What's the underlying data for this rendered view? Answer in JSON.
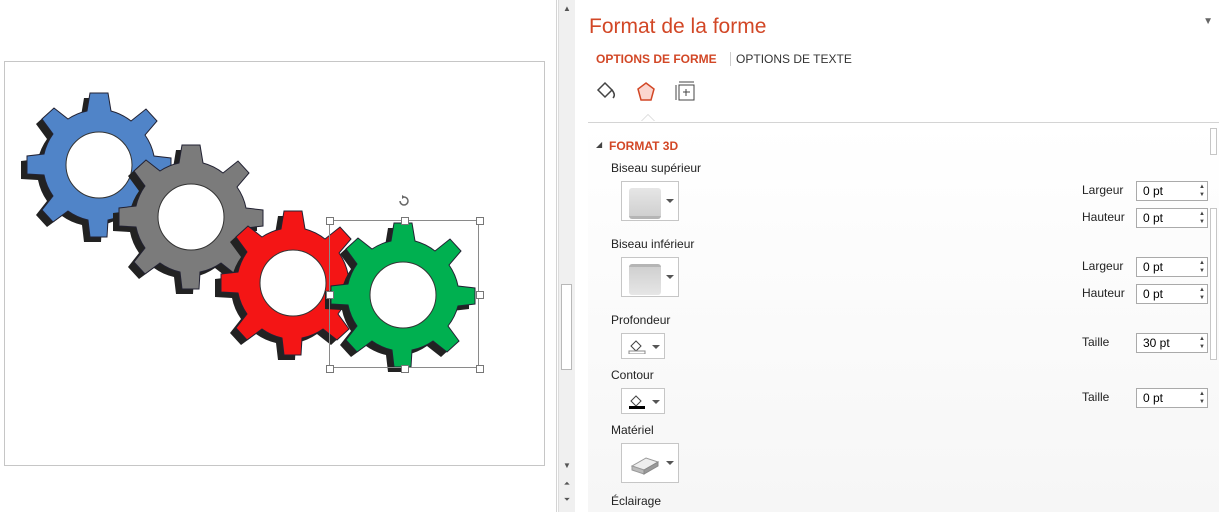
{
  "slide": {
    "gears": [
      {
        "name": "blue",
        "color": "#5084c8"
      },
      {
        "name": "gray",
        "color": "#7b7b7b"
      },
      {
        "name": "red",
        "color": "#f41515"
      },
      {
        "name": "green",
        "color": "#00b050"
      }
    ]
  },
  "panel": {
    "title": "Format de la forme",
    "tabs": [
      "OPTIONS DE FORME",
      "OPTIONS DE TEXTE"
    ],
    "icons": [
      "fill-line-icon",
      "effects-icon",
      "size-properties-icon"
    ],
    "section_title": "FORMAT 3D",
    "bevel_top_label": "Biseau supérieur",
    "bevel_bottom_label": "Biseau inférieur",
    "depth_label": "Profondeur",
    "contour_label": "Contour",
    "material_label": "Matériel",
    "lighting_label": "Éclairage",
    "width_label": "Largeur",
    "height_label": "Hauteur",
    "size_label": "Taille",
    "values": {
      "top_width": "0 pt",
      "top_height": "0 pt",
      "bottom_width": "0 pt",
      "bottom_height": "0 pt",
      "depth_size": "30 pt",
      "contour_size": "0 pt"
    },
    "accent_color": "#d24726"
  }
}
